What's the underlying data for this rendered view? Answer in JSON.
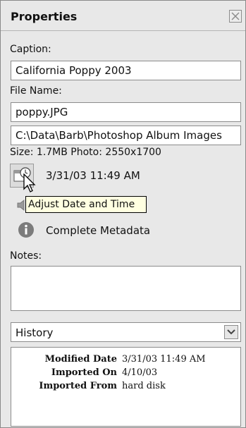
{
  "panel": {
    "title": "Properties",
    "close_icon": "close-icon"
  },
  "caption": {
    "label": "Caption:",
    "value": "California Poppy 2003"
  },
  "file_name": {
    "label": "File Name:",
    "value": "poppy.JPG",
    "path": "C:\\Data\\Barb\\Photoshop Album Images"
  },
  "size_info": "Size: 1.7MB  Photo: 2550x1700",
  "date": {
    "value": "3/31/03 11:49 AM",
    "button_icon": "calendar-clock-icon",
    "tooltip": "Adjust Date and Time"
  },
  "audio_icon": "speaker-icon",
  "metadata": {
    "label": "Complete Metadata",
    "icon": "info-icon"
  },
  "notes": {
    "label": "Notes:",
    "value": ""
  },
  "history": {
    "selected": "History",
    "dropdown_icon": "chevron-down-icon",
    "rows": [
      {
        "key": "Modified Date",
        "value": "3/31/03 11:49 AM"
      },
      {
        "key": "Imported On",
        "value": "4/10/03"
      },
      {
        "key": "Imported From",
        "value": "hard disk"
      }
    ]
  }
}
